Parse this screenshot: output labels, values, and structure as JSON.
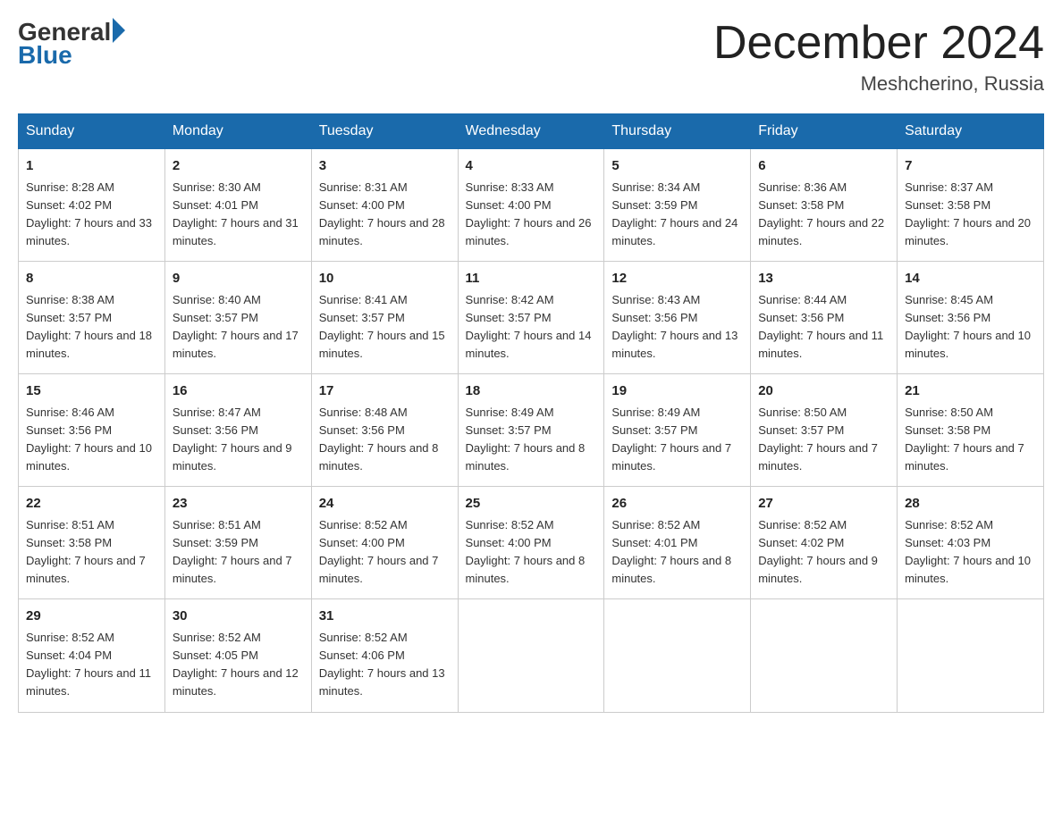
{
  "logo": {
    "general": "General",
    "blue": "Blue"
  },
  "title": "December 2024",
  "location": "Meshcherino, Russia",
  "weekdays": [
    "Sunday",
    "Monday",
    "Tuesday",
    "Wednesday",
    "Thursday",
    "Friday",
    "Saturday"
  ],
  "weeks": [
    [
      {
        "day": "1",
        "sunrise": "8:28 AM",
        "sunset": "4:02 PM",
        "daylight": "7 hours and 33 minutes."
      },
      {
        "day": "2",
        "sunrise": "8:30 AM",
        "sunset": "4:01 PM",
        "daylight": "7 hours and 31 minutes."
      },
      {
        "day": "3",
        "sunrise": "8:31 AM",
        "sunset": "4:00 PM",
        "daylight": "7 hours and 28 minutes."
      },
      {
        "day": "4",
        "sunrise": "8:33 AM",
        "sunset": "4:00 PM",
        "daylight": "7 hours and 26 minutes."
      },
      {
        "day": "5",
        "sunrise": "8:34 AM",
        "sunset": "3:59 PM",
        "daylight": "7 hours and 24 minutes."
      },
      {
        "day": "6",
        "sunrise": "8:36 AM",
        "sunset": "3:58 PM",
        "daylight": "7 hours and 22 minutes."
      },
      {
        "day": "7",
        "sunrise": "8:37 AM",
        "sunset": "3:58 PM",
        "daylight": "7 hours and 20 minutes."
      }
    ],
    [
      {
        "day": "8",
        "sunrise": "8:38 AM",
        "sunset": "3:57 PM",
        "daylight": "7 hours and 18 minutes."
      },
      {
        "day": "9",
        "sunrise": "8:40 AM",
        "sunset": "3:57 PM",
        "daylight": "7 hours and 17 minutes."
      },
      {
        "day": "10",
        "sunrise": "8:41 AM",
        "sunset": "3:57 PM",
        "daylight": "7 hours and 15 minutes."
      },
      {
        "day": "11",
        "sunrise": "8:42 AM",
        "sunset": "3:57 PM",
        "daylight": "7 hours and 14 minutes."
      },
      {
        "day": "12",
        "sunrise": "8:43 AM",
        "sunset": "3:56 PM",
        "daylight": "7 hours and 13 minutes."
      },
      {
        "day": "13",
        "sunrise": "8:44 AM",
        "sunset": "3:56 PM",
        "daylight": "7 hours and 11 minutes."
      },
      {
        "day": "14",
        "sunrise": "8:45 AM",
        "sunset": "3:56 PM",
        "daylight": "7 hours and 10 minutes."
      }
    ],
    [
      {
        "day": "15",
        "sunrise": "8:46 AM",
        "sunset": "3:56 PM",
        "daylight": "7 hours and 10 minutes."
      },
      {
        "day": "16",
        "sunrise": "8:47 AM",
        "sunset": "3:56 PM",
        "daylight": "7 hours and 9 minutes."
      },
      {
        "day": "17",
        "sunrise": "8:48 AM",
        "sunset": "3:56 PM",
        "daylight": "7 hours and 8 minutes."
      },
      {
        "day": "18",
        "sunrise": "8:49 AM",
        "sunset": "3:57 PM",
        "daylight": "7 hours and 8 minutes."
      },
      {
        "day": "19",
        "sunrise": "8:49 AM",
        "sunset": "3:57 PM",
        "daylight": "7 hours and 7 minutes."
      },
      {
        "day": "20",
        "sunrise": "8:50 AM",
        "sunset": "3:57 PM",
        "daylight": "7 hours and 7 minutes."
      },
      {
        "day": "21",
        "sunrise": "8:50 AM",
        "sunset": "3:58 PM",
        "daylight": "7 hours and 7 minutes."
      }
    ],
    [
      {
        "day": "22",
        "sunrise": "8:51 AM",
        "sunset": "3:58 PM",
        "daylight": "7 hours and 7 minutes."
      },
      {
        "day": "23",
        "sunrise": "8:51 AM",
        "sunset": "3:59 PM",
        "daylight": "7 hours and 7 minutes."
      },
      {
        "day": "24",
        "sunrise": "8:52 AM",
        "sunset": "4:00 PM",
        "daylight": "7 hours and 7 minutes."
      },
      {
        "day": "25",
        "sunrise": "8:52 AM",
        "sunset": "4:00 PM",
        "daylight": "7 hours and 8 minutes."
      },
      {
        "day": "26",
        "sunrise": "8:52 AM",
        "sunset": "4:01 PM",
        "daylight": "7 hours and 8 minutes."
      },
      {
        "day": "27",
        "sunrise": "8:52 AM",
        "sunset": "4:02 PM",
        "daylight": "7 hours and 9 minutes."
      },
      {
        "day": "28",
        "sunrise": "8:52 AM",
        "sunset": "4:03 PM",
        "daylight": "7 hours and 10 minutes."
      }
    ],
    [
      {
        "day": "29",
        "sunrise": "8:52 AM",
        "sunset": "4:04 PM",
        "daylight": "7 hours and 11 minutes."
      },
      {
        "day": "30",
        "sunrise": "8:52 AM",
        "sunset": "4:05 PM",
        "daylight": "7 hours and 12 minutes."
      },
      {
        "day": "31",
        "sunrise": "8:52 AM",
        "sunset": "4:06 PM",
        "daylight": "7 hours and 13 minutes."
      },
      null,
      null,
      null,
      null
    ]
  ]
}
